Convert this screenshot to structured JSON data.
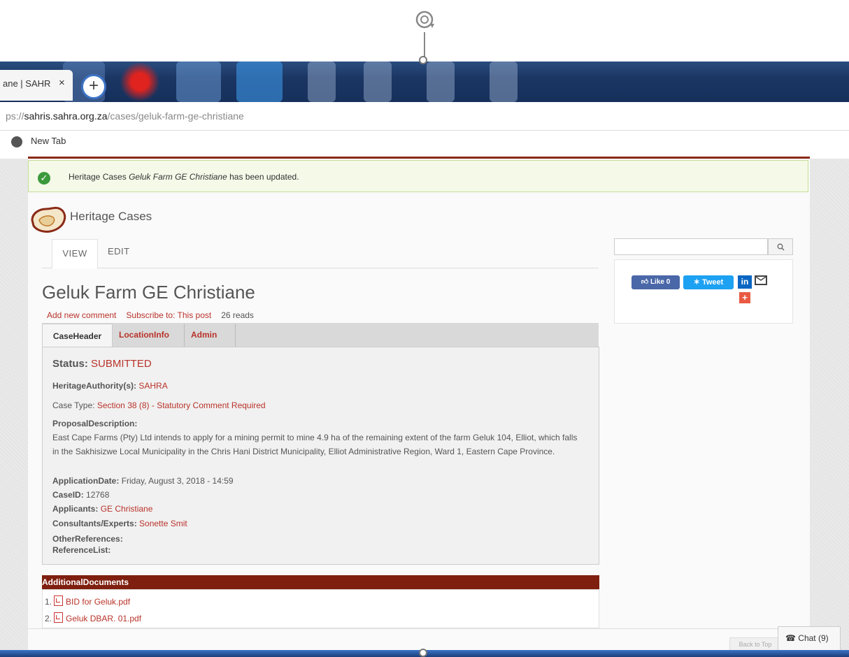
{
  "browser": {
    "tab_title": "ane | SAHR",
    "tab_close": "×",
    "new_tab_symbol": "+",
    "url_prefix": "ps://",
    "url_host": "sahris.sahra.org.za",
    "url_path": "/cases/geluk-farm-ge-christiane",
    "bookmark_label": "New Tab"
  },
  "status_message": {
    "prefix": "Heritage Cases",
    "item": "Geluk Farm GE Christiane",
    "suffix": "has been updated."
  },
  "site": {
    "name": "Heritage Cases"
  },
  "tabs": {
    "view": "VIEW",
    "edit": "EDIT"
  },
  "node": {
    "title": "Geluk Farm GE Christiane",
    "links": {
      "add_comment": "Add new comment",
      "subscribe": "Subscribe to: This post",
      "reads": "26 reads"
    }
  },
  "inner_tabs": {
    "caseheader": "CaseHeader",
    "locationinfo": "LocationInfo",
    "admin": "Admin"
  },
  "case": {
    "status_label": "Status:",
    "status_value": "SUBMITTED",
    "authority_label": "HeritageAuthority(s):",
    "authority_value": "SAHRA",
    "case_type_label": "Case Type:",
    "case_type_value": "Section 38 (8) - Statutory Comment Required",
    "proposal_label": "ProposalDescription:",
    "proposal_text": "East Cape Farms (Pty) Ltd intends to apply for a mining permit to mine 4.9 ha of the remaining extent of the farm Geluk 104, Elliot, which falls in the Sakhisizwe Local Municipality in the Chris Hani District Municipality, Elliot Administrative Region, Ward 1, Eastern Cape Province.",
    "application_date_label": "ApplicationDate:",
    "application_date_value": "Friday, August 3, 2018 - 14:59",
    "caseid_label": "CaseID:",
    "caseid_value": "12768",
    "applicants_label": "Applicants:",
    "applicants_value": "GE Christiane",
    "consultants_label": "Consultants/Experts:",
    "consultants_value": "Sonette Smit",
    "other_refs_label": "OtherReferences:",
    "ref_list_label": "ReferenceList:"
  },
  "documents": {
    "header": "AdditionalDocuments",
    "items": [
      {
        "num": "1.",
        "name": "BID for Geluk.pdf"
      },
      {
        "num": "2.",
        "name": "Geluk DBAR. 01.pdf"
      }
    ]
  },
  "sidebar": {
    "search_placeholder": "",
    "share": {
      "like": "Like 0",
      "tweet": "Tweet",
      "linkedin": "in",
      "plus": "+"
    }
  },
  "footer": {
    "back_to_top": "Back to Top",
    "chat": "Chat (9)"
  }
}
